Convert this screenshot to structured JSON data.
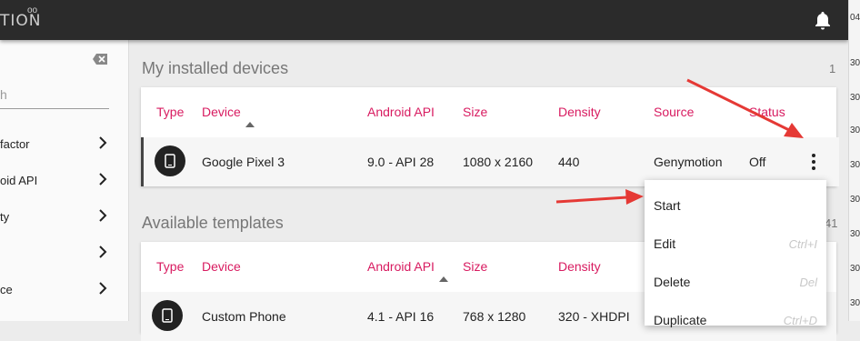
{
  "app": {
    "logo_text": "TION",
    "logo_sup": "oo"
  },
  "sidebar": {
    "search_placeholder": "h",
    "filters": [
      {
        "label": "factor"
      },
      {
        "label": "oid API"
      },
      {
        "label": "ty"
      },
      {
        "label": ""
      },
      {
        "label": "ce"
      }
    ]
  },
  "installed": {
    "title": "My installed devices",
    "count": "1",
    "columns": {
      "type": "Type",
      "device": "Device",
      "api": "Android API",
      "size": "Size",
      "density": "Density",
      "source": "Source",
      "status": "Status"
    },
    "rows": [
      {
        "device": "Google Pixel 3",
        "api": "9.0 - API 28",
        "size": "1080 x 2160",
        "density": "440",
        "source": "Genymotion",
        "status": "Off"
      }
    ]
  },
  "templates": {
    "title": "Available templates",
    "count": "41",
    "columns": {
      "type": "Type",
      "device": "Device",
      "api": "Android API",
      "size": "Size",
      "density": "Density"
    },
    "rows": [
      {
        "device": "Custom Phone",
        "api": "4.1 - API 16",
        "size": "768 x 1280",
        "density": "320 - XHDPI"
      }
    ]
  },
  "context_menu": {
    "items": [
      {
        "label": "Start",
        "shortcut": ""
      },
      {
        "label": "Edit",
        "shortcut": "Ctrl+I"
      },
      {
        "label": "Delete",
        "shortcut": "Del"
      },
      {
        "label": "Duplicate",
        "shortcut": "Ctrl+D"
      }
    ]
  },
  "right_strip": [
    "04",
    "30",
    "30",
    "30",
    "30",
    "30",
    "30",
    "30",
    "30"
  ],
  "colors": {
    "accent": "#d81b60",
    "topbar": "#2b2b2b",
    "annotation_arrow": "#e53935"
  }
}
